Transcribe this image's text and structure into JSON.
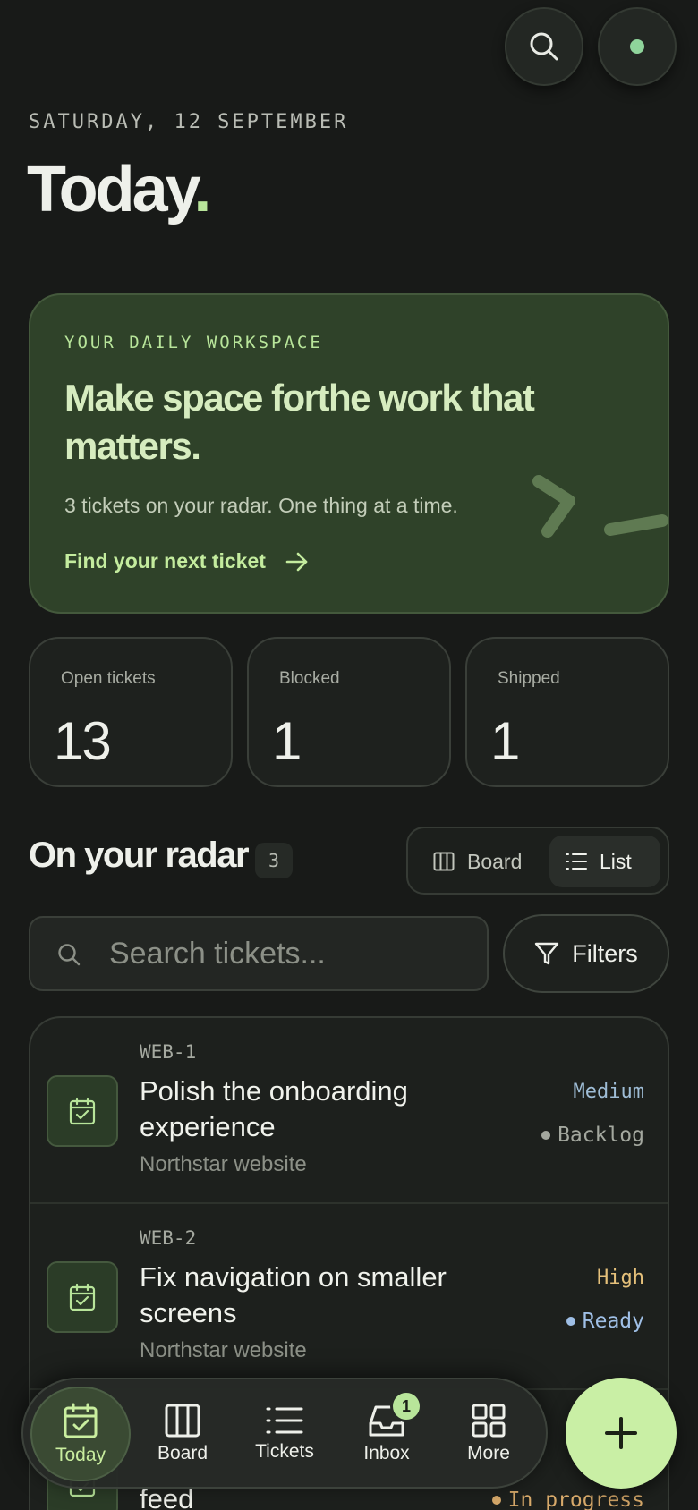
{
  "header": {
    "date": "SATURDAY, 12 SEPTEMBER",
    "title": "Today",
    "title_punct": ".",
    "search_icon": "search-icon",
    "status_color": "#8fd49b"
  },
  "hero": {
    "eyebrow": "YOUR DAILY WORKSPACE",
    "headline": "Make space forthe work that matters.",
    "subtext": "3 tickets on your radar. One thing at a time.",
    "cta": "Find your next ticket",
    "cta_icon": "arrow-right-icon"
  },
  "stats": [
    {
      "label": "Open tickets",
      "value": "13"
    },
    {
      "label": "Blocked",
      "value": "1"
    },
    {
      "label": "Shipped",
      "value": "1"
    }
  ],
  "radar": {
    "title": "On your radar",
    "count": "3",
    "views": {
      "board": "Board",
      "list": "List",
      "selected": "List"
    }
  },
  "search": {
    "placeholder": "Search tickets...",
    "filters_label": "Filters"
  },
  "tickets": [
    {
      "key": "WEB-1",
      "title": "Polish the onboarding experience",
      "project": "Northstar website",
      "priority": "Medium",
      "priority_color": "#9fbdd6",
      "status": "Backlog",
      "status_color": "#a3a79e"
    },
    {
      "key": "WEB-2",
      "title": "Fix navigation on smaller screens",
      "project": "Northstar website",
      "priority": "High",
      "priority_color": "#e5c07a",
      "status": "Ready",
      "status_color": "#9fbfe6"
    },
    {
      "title_tail": "feed",
      "status": "In progress",
      "status_color": "#d7a96a"
    }
  ],
  "nav": {
    "items": [
      {
        "label": "Today",
        "icon": "calendar-check-icon",
        "active": true
      },
      {
        "label": "Board",
        "icon": "board-columns-icon"
      },
      {
        "label": "Tickets",
        "icon": "list-icon"
      },
      {
        "label": "Inbox",
        "icon": "inbox-icon",
        "badge": "1"
      },
      {
        "label": "More",
        "icon": "grid-icon"
      }
    ],
    "fab_icon": "plus-icon"
  },
  "colors": {
    "accent": "#b8e59a",
    "background": "#181a18",
    "hero_bg": "#2f4229"
  }
}
